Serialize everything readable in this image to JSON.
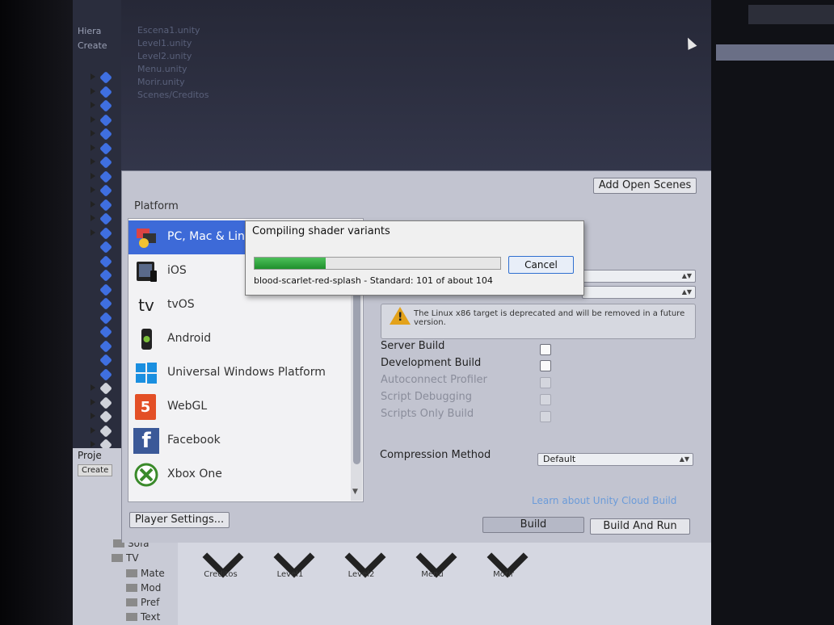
{
  "colors": {
    "selection": "#3d6ad8",
    "progress": "#2ea63c",
    "warning": "#e3a21a",
    "link": "#6b9bd9"
  },
  "hierarchy": {
    "header": [
      "Hiera",
      "Create"
    ],
    "scene_lines": [
      "Escena1.unity",
      "Level1.unity",
      "Level2.unity",
      "Menu.unity",
      "Morir.unity",
      "Scenes/Creditos"
    ]
  },
  "build_settings": {
    "add_open_scenes_label": "Add Open Scenes",
    "platform_heading": "Platform",
    "platforms": [
      {
        "label": "PC, Mac & Linux Standalone",
        "icon": "pc-mac-linux-icon",
        "selected": true
      },
      {
        "label": "iOS",
        "icon": "ios-device-icon",
        "selected": false
      },
      {
        "label": "tvOS",
        "icon": "apple-tv-icon",
        "icon_text": "tv",
        "selected": false
      },
      {
        "label": "Android",
        "icon": "android-device-icon",
        "selected": false
      },
      {
        "label": "Universal Windows Platform",
        "icon": "windows-logo-icon",
        "selected": false
      },
      {
        "label": "WebGL",
        "icon": "html5-logo-icon",
        "icon_text": "5",
        "selected": false
      },
      {
        "label": "Facebook",
        "icon": "facebook-logo-icon",
        "icon_text": "f",
        "selected": false
      },
      {
        "label": "Xbox One",
        "icon": "xbox-logo-icon",
        "selected": false
      }
    ],
    "player_settings_label": "Player Settings...",
    "warning_text": "The Linux x86 target is deprecated and will be removed in a future version.",
    "options": [
      {
        "label": "Server Build",
        "enabled": true,
        "checked": false
      },
      {
        "label": "Development Build",
        "enabled": true,
        "checked": false
      },
      {
        "label": "Autoconnect Profiler",
        "enabled": false,
        "checked": false
      },
      {
        "label": "Script Debugging",
        "enabled": false,
        "checked": false
      },
      {
        "label": "Scripts Only Build",
        "enabled": false,
        "checked": false
      }
    ],
    "compression_label": "Compression Method",
    "compression_value": "Default",
    "cloud_link": "Learn about Unity Cloud Build",
    "build_label": "Build",
    "build_and_run_label": "Build And Run"
  },
  "progress_dialog": {
    "title": "Compiling shader variants",
    "status": "blood-scarlet-red-splash - Standard: 101 of about 104",
    "cancel_label": "Cancel",
    "progress_fraction": 0.29
  },
  "project": {
    "tab_label": "Proje",
    "create_label": "Create",
    "folders": [
      "Sofa",
      "TV",
      "Mate",
      "Mod",
      "Pref",
      "Text"
    ],
    "assets": [
      "Creditos",
      "Level1",
      "Level2",
      "Menu",
      "Morir"
    ]
  }
}
